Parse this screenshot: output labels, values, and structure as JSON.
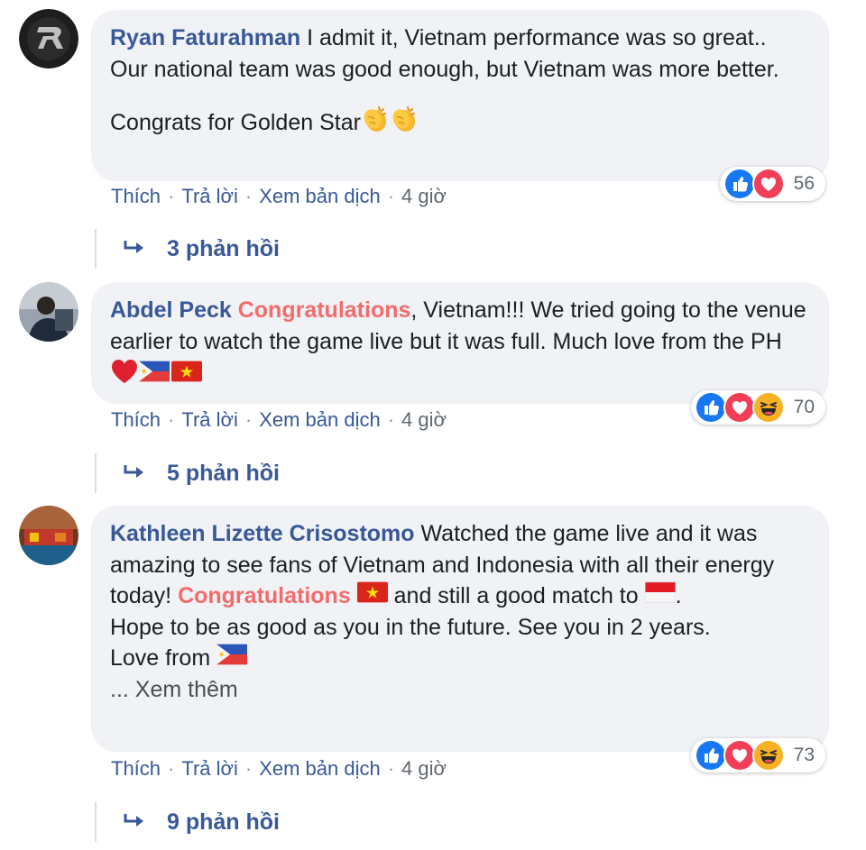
{
  "actions": {
    "like": "Thích",
    "reply": "Trả lời",
    "translate": "Xem bản dịch",
    "separator": "·"
  },
  "colors": {
    "author_link": "#385898",
    "congrats_highlight": "#f56b6b",
    "bubble_bg": "#f0f2f5",
    "like_blue": "#1877f2",
    "love_red": "#f33e58",
    "haha_yellow": "#f7b125"
  },
  "comments": [
    {
      "author": "Ryan Faturahman",
      "text_1": "I admit it, Vietnam performance was so great.. Our national team was good enough, but Vietnam was more better.",
      "text_2": "Congrats for Golden Star",
      "text_2_emoji": [
        "clapping-hands",
        "clapping-hands"
      ],
      "time": "4 giờ",
      "reaction_icons": [
        "like",
        "love"
      ],
      "reaction_count": "56",
      "replies": "3 phản hồi"
    },
    {
      "author": "Abdel Peck",
      "highlight": "Congratulations",
      "text_after_highlight": ", Vietnam!!! We tried going to the venue earlier to watch the game live but it was full. Much love from the PH",
      "emoji": [
        "red-heart",
        "philippines-flag",
        "vietnam-flag"
      ],
      "time": "4 giờ",
      "reaction_icons": [
        "like",
        "love",
        "haha"
      ],
      "reaction_count": "70",
      "replies": "5 phản hồi"
    },
    {
      "author": "Kathleen Lizette Crisostomo",
      "text_before_highlight": "Watched the game live and it was amazing to see fans of Vietnam and Indonesia with all their energy today!",
      "highlight": "Congratulations",
      "text_after_highlight": "and still a good match to",
      "text_end": ".",
      "text_2": "Hope to be as good as you in the future. See you in 2 years.",
      "text_3": "Love from",
      "emoji": [
        "vietnam-flag",
        "indonesia-flag",
        "philippines-flag"
      ],
      "see_more": "... Xem thêm",
      "time": "4 giờ",
      "reaction_icons": [
        "like",
        "love",
        "haha"
      ],
      "reaction_count": "73",
      "replies": "9 phản hồi"
    }
  ]
}
